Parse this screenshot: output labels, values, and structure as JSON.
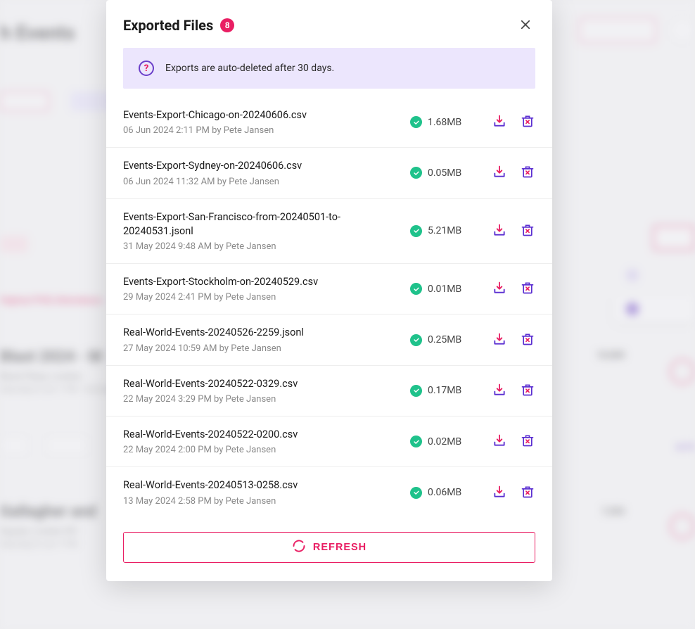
{
  "modal": {
    "title": "Exported Files",
    "badge_count": "8",
    "info_message": "Exports are auto-deleted after 30 days.",
    "refresh_label": "REFRESH"
  },
  "files": [
    {
      "name": "Events-Export-Chicago-on-20240606.csv",
      "meta": "06 Jun 2024 2:11 PM by Pete Jansen",
      "size": "1.68MB"
    },
    {
      "name": "Events-Export-Sydney-on-20240606.csv",
      "meta": "06 Jun 2024 11:32 AM by Pete Jansen",
      "size": "0.05MB"
    },
    {
      "name": "Events-Export-San-Francisco-from-20240501-to-20240531.jsonl",
      "meta": "31 May 2024 9:48 AM by Pete Jansen",
      "size": "5.21MB"
    },
    {
      "name": "Events-Export-Stockholm-on-20240529.csv",
      "meta": "29 May 2024 2:41 PM by Pete Jansen",
      "size": "0.01MB"
    },
    {
      "name": "Real-World-Events-20240526-2259.jsonl",
      "meta": "27 May 2024 10:59 AM by Pete Jansen",
      "size": "0.25MB"
    },
    {
      "name": "Real-World-Events-20240522-0329.csv",
      "meta": "22 May 2024 3:29 PM by Pete Jansen",
      "size": "0.17MB"
    },
    {
      "name": "Real-World-Events-20240522-0200.csv",
      "meta": "22 May 2024 2:00 PM by Pete Jansen",
      "size": "0.02MB"
    },
    {
      "name": "Real-World-Events-20240513-0258.csv",
      "meta": "13 May 2024 2:58 PM by Pete Jansen",
      "size": "0.06MB"
    }
  ],
  "colors": {
    "accent_pink": "#e91e63",
    "accent_purple": "#6b3fc9",
    "success_green": "#1fc28b",
    "banner_bg": "#ece6fd"
  }
}
